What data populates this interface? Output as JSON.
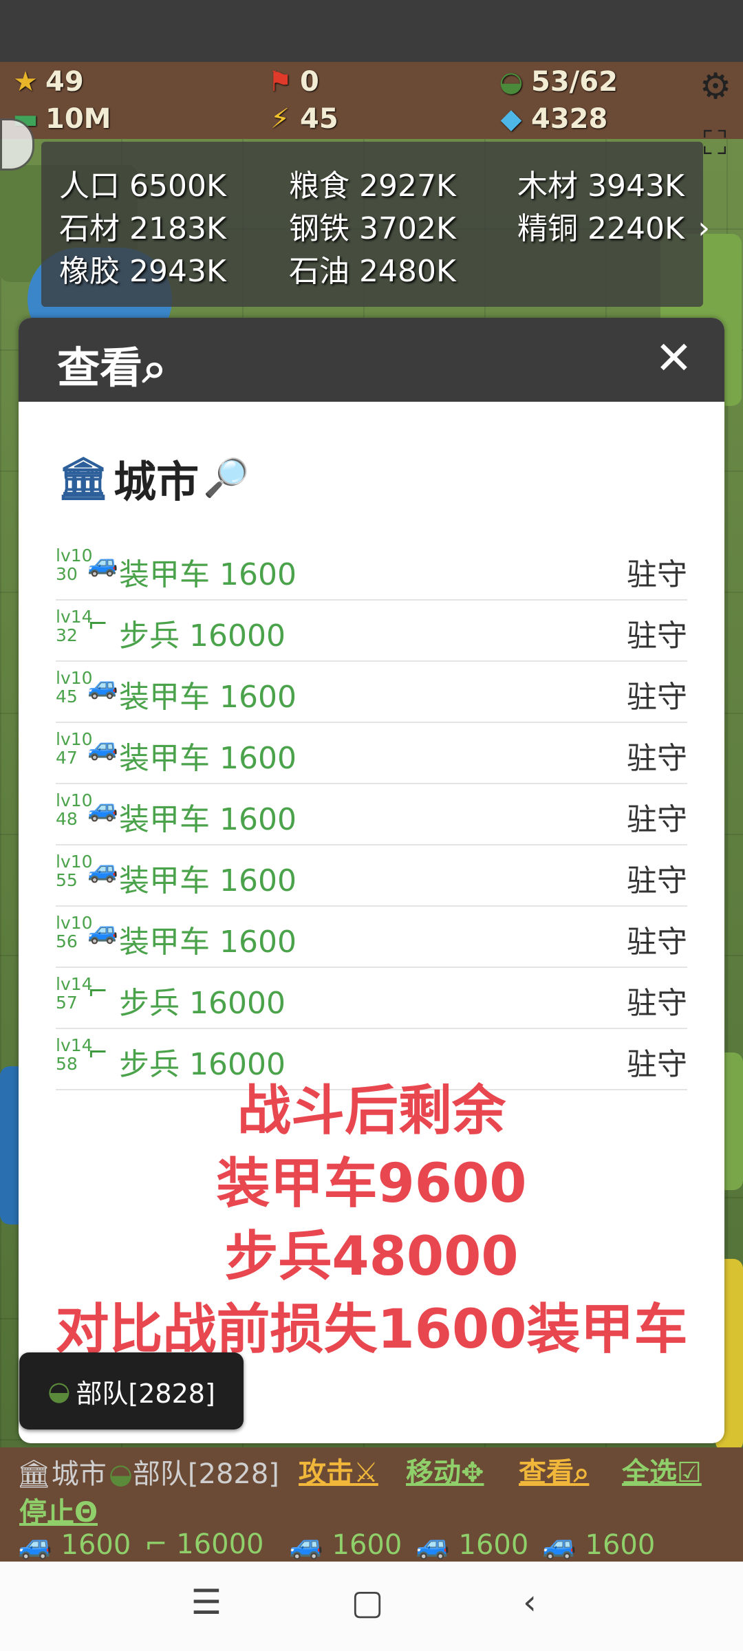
{
  "top_hud": {
    "rank": "49",
    "flags": "0",
    "troops": "53/62",
    "money": "10M",
    "energy": "45",
    "gems": "4328"
  },
  "resources": [
    {
      "name": "人口",
      "value": "6500K"
    },
    {
      "name": "粮食",
      "value": "2927K"
    },
    {
      "name": "木材",
      "value": "3943K"
    },
    {
      "name": "石材",
      "value": "2183K"
    },
    {
      "name": "钢铁",
      "value": "3702K"
    },
    {
      "name": "精铜",
      "value": "2240K"
    },
    {
      "name": "橡胶",
      "value": "2943K"
    },
    {
      "name": "石油",
      "value": "2480K"
    }
  ],
  "modal": {
    "title": "查看⌕",
    "close": "✕",
    "city_label": "城市",
    "units": [
      {
        "lv": "lv10",
        "id": "30",
        "icon": "🚙",
        "name": "装甲车 1600",
        "status": "驻守"
      },
      {
        "lv": "lv14",
        "id": "32",
        "icon": "⌐",
        "name": "步兵 16000",
        "status": "驻守"
      },
      {
        "lv": "lv10",
        "id": "45",
        "icon": "🚙",
        "name": "装甲车 1600",
        "status": "驻守"
      },
      {
        "lv": "lv10",
        "id": "47",
        "icon": "🚙",
        "name": "装甲车 1600",
        "status": "驻守"
      },
      {
        "lv": "lv10",
        "id": "48",
        "icon": "🚙",
        "name": "装甲车 1600",
        "status": "驻守"
      },
      {
        "lv": "lv10",
        "id": "55",
        "icon": "🚙",
        "name": "装甲车 1600",
        "status": "驻守"
      },
      {
        "lv": "lv10",
        "id": "56",
        "icon": "🚙",
        "name": "装甲车 1600",
        "status": "驻守"
      },
      {
        "lv": "lv14",
        "id": "57",
        "icon": "⌐",
        "name": "步兵 16000",
        "status": "驻守"
      },
      {
        "lv": "lv14",
        "id": "58",
        "icon": "⌐",
        "name": "步兵 16000",
        "status": "驻守"
      }
    ],
    "summary": [
      "战斗后剩余",
      "装甲车9600",
      "步兵48000",
      "对比战前损失1600装甲车"
    ]
  },
  "troop_pill": "部队[2828]",
  "toolbar": {
    "city": "城市",
    "troops": "部队[2828]",
    "attack": "攻击⚔",
    "move": "移动✥",
    "view": "查看⌕",
    "select_all": "全选☑",
    "stop": "停止Θ",
    "chips": [
      "1600",
      "16000",
      "1600",
      "1600",
      "1600"
    ]
  },
  "colors": {
    "accent_red": "#e8474f",
    "unit_green": "#4aa24a",
    "hud_brown": "#6b4a36"
  }
}
